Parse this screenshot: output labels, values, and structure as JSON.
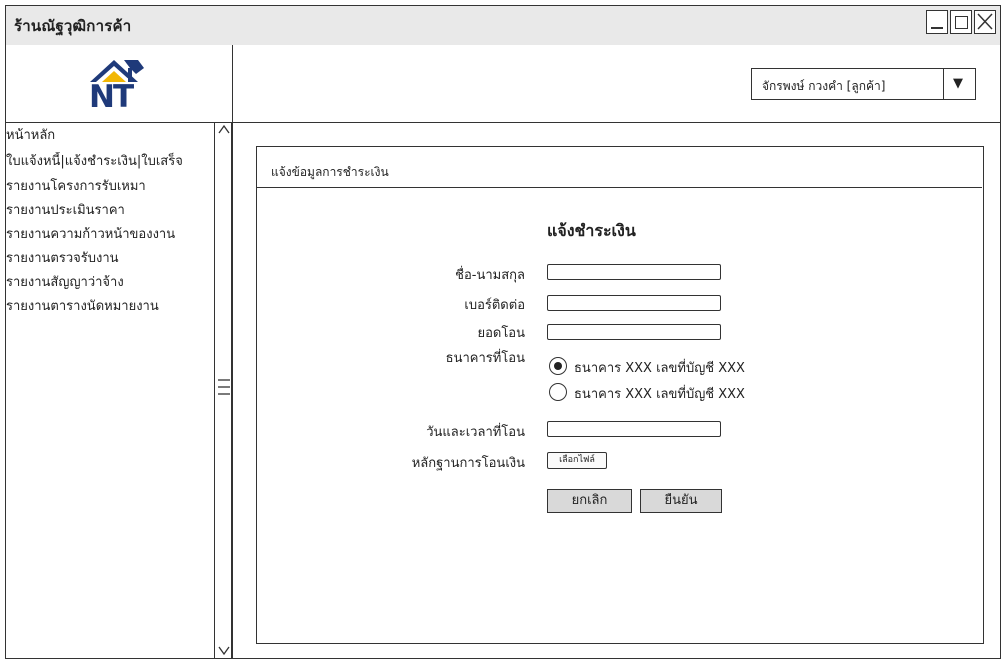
{
  "window": {
    "title": "ร้านณัฐวุฒิการค้า",
    "controls": [
      "minimize-icon",
      "maximize-icon",
      "close-icon"
    ]
  },
  "logo": {
    "text": "NT",
    "colors": {
      "roof": "#f2b705",
      "letters": "#1f3a7a"
    }
  },
  "header": {
    "user_select_value": "จักรพงษ์ กวงคำ [ลูกค้า]",
    "dropdown_icon": "triangle-down-icon"
  },
  "sidebar": {
    "items": [
      {
        "label": "หน้าหลัก"
      },
      {
        "label": "ใบแจ้งหนี้|แจ้งชำระเงิน|ใบเสร็จ"
      },
      {
        "label": "รายงานโครงการรับเหมา"
      },
      {
        "label": "รายงานประเมินราคา"
      },
      {
        "label": "รายงานความก้าวหน้าของงาน"
      },
      {
        "label": "รายงานตรวจรับงาน"
      },
      {
        "label": "รายงานสัญญาว่าจ้าง"
      },
      {
        "label": "รายงานตารางนัดหมายงาน"
      }
    ],
    "scroll_icons": [
      "chevron-up-icon",
      "scroll-grip-icon",
      "chevron-down-icon"
    ]
  },
  "panel": {
    "title": "แจ้งข้อมูลการชำระเงิน",
    "form": {
      "heading": "แจ้งชำระเงิน",
      "name_label": "ชื่อ-นามสกุล",
      "phone_label": "เบอร์ติดต่อ",
      "amount_label": "ยอดโอน",
      "bank_label": "ธนาคารที่โอน",
      "bank_options": [
        {
          "label": "ธนาคาร XXX เลขที่บัญชี XXX",
          "selected": true
        },
        {
          "label": "ธนาคาร XXX เลขที่บัญชี XXX",
          "selected": false
        }
      ],
      "datetime_label": "วันและเวลาที่โอน",
      "evidence_label": "หลักฐานการโอนเงิน",
      "file_button": "เลือกไฟล์",
      "cancel_button": "ยกเลิก",
      "confirm_button": "ยืนยัน"
    }
  }
}
